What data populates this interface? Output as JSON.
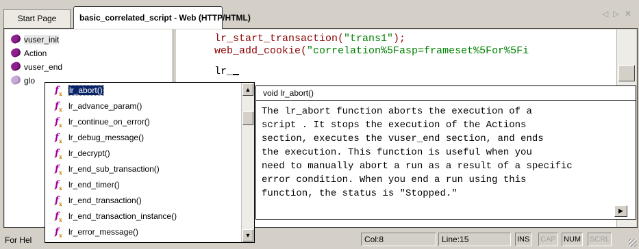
{
  "tabs": [
    {
      "label": "Start Page"
    },
    {
      "label": "basic_correlated_script - Web (HTTP/HTML)"
    }
  ],
  "tab_nav": {
    "prev": "◁",
    "next": "▷",
    "close": "✕"
  },
  "tree": {
    "items": [
      {
        "label": "vuser_init"
      },
      {
        "label": "Action"
      },
      {
        "label": "vuser_end"
      },
      {
        "label": "glo"
      }
    ]
  },
  "editor": {
    "lines": [
      {
        "text": "lr_start_transaction(\"trans1\");"
      },
      {
        "text": "web_add_cookie(\"correlation%5Fasp=frameset%5For%5Fi"
      },
      {
        "text": "lr_"
      }
    ]
  },
  "autocomplete": {
    "items": [
      {
        "label": "lr_abort()"
      },
      {
        "label": "lr_advance_param()"
      },
      {
        "label": "lr_continue_on_error()"
      },
      {
        "label": "lr_debug_message()"
      },
      {
        "label": "lr_decrypt()"
      },
      {
        "label": "lr_end_sub_transaction()"
      },
      {
        "label": "lr_end_timer()"
      },
      {
        "label": "lr_end_transaction()"
      },
      {
        "label": "lr_end_transaction_instance()"
      },
      {
        "label": "lr_error_message()"
      }
    ],
    "icon_glyph": "f",
    "icon_sub": "x"
  },
  "tooltip": {
    "signature": "void lr_abort()",
    "lines": [
      "The lr_abort function aborts the execution of a",
      "script . It stops the execution of the Actions",
      "section, executes the vuser_end section, and ends",
      "the execution. This function is useful when you",
      "need to manually abort a run as a result of a specific",
      "error condition. When you end a run using this",
      "function, the status is \"Stopped.\""
    ]
  },
  "statusbar": {
    "help_text": "For Hel",
    "col": "Col:8",
    "line": "Line:15",
    "indicators": [
      {
        "label": "INS",
        "active": true
      },
      {
        "label": "CAP",
        "active": false
      },
      {
        "label": "NUM",
        "active": true
      },
      {
        "label": "SCRL",
        "active": false
      }
    ]
  },
  "colors": {
    "tree_icon": "#8e1f8e",
    "function_keyword": "#8b0000",
    "string_literal": "#008000",
    "selection": "#0a246a"
  }
}
